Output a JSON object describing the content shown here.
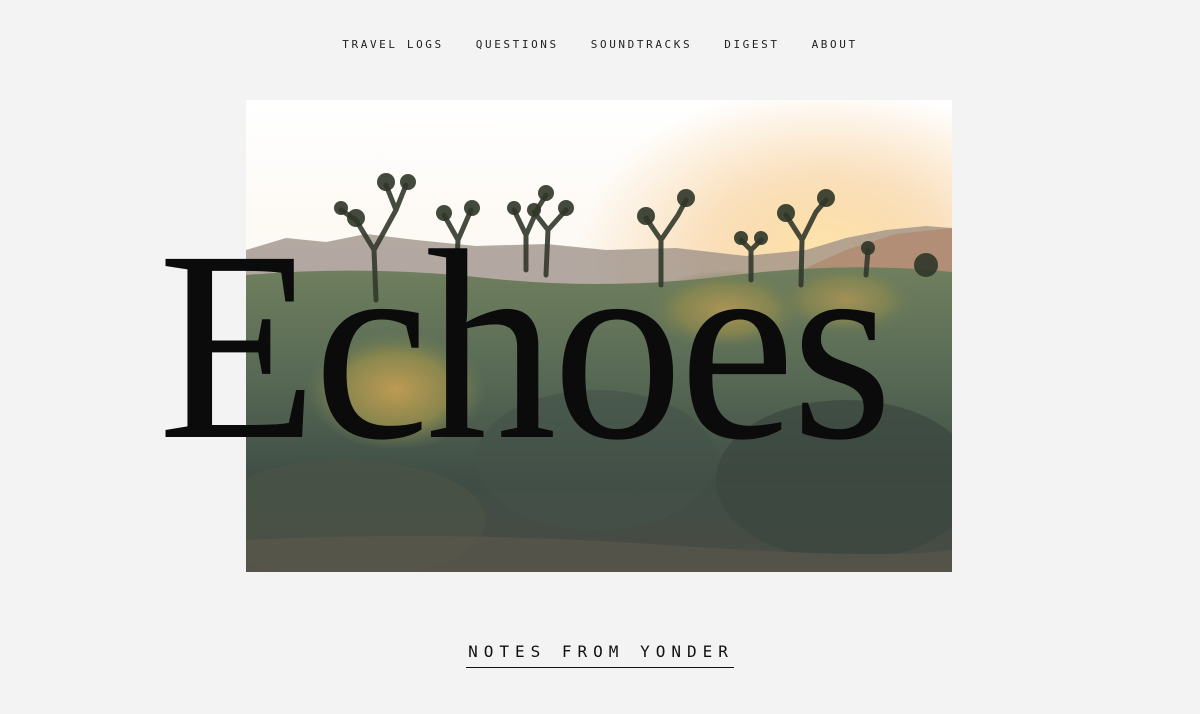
{
  "nav": {
    "items": [
      {
        "label": "TRAVEL LOGS"
      },
      {
        "label": "QUESTIONS"
      },
      {
        "label": "SOUNDTRACKS"
      },
      {
        "label": "DIGEST"
      },
      {
        "label": "ABOUT"
      }
    ]
  },
  "hero": {
    "title": "Echoes",
    "photo_subject": "desert-landscape-with-joshua-trees-at-sunset"
  },
  "tagline": {
    "label": "NOTES FROM YONDER"
  },
  "colors": {
    "background": "#f3f3f3",
    "text": "#111111",
    "sky_glow": "#f6c27a"
  }
}
